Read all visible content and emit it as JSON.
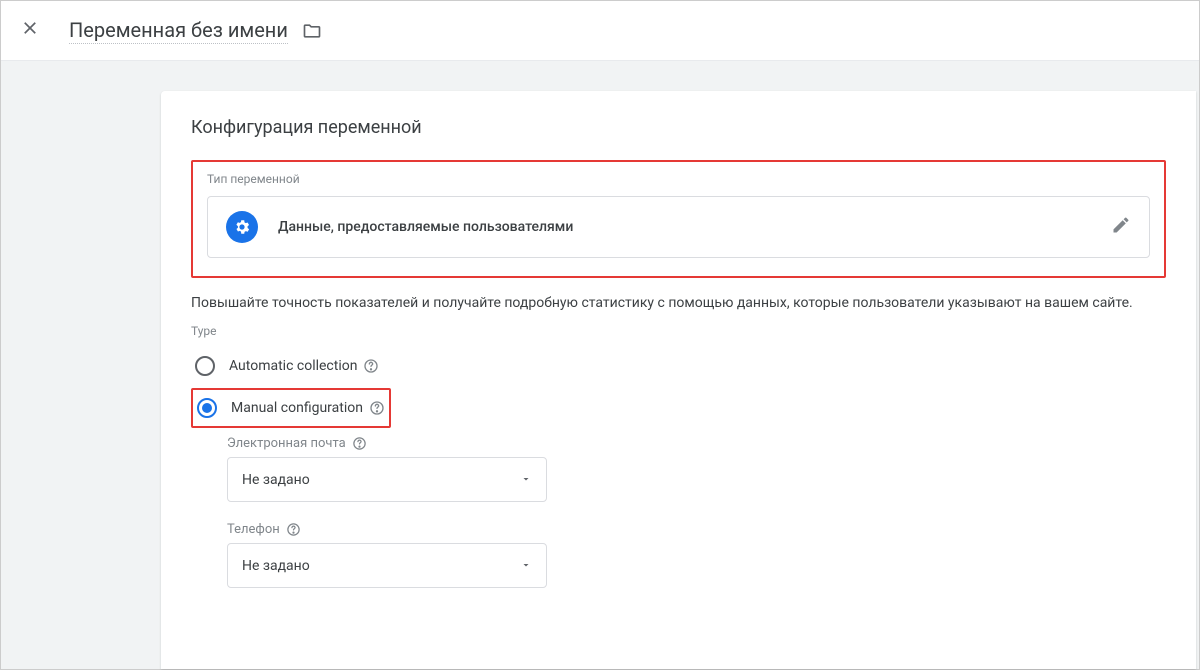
{
  "header": {
    "title": "Переменная без имени"
  },
  "card": {
    "title": "Конфигурация переменной"
  },
  "variable_type": {
    "label": "Тип переменной",
    "name": "Данные, предоставляемые пользователями"
  },
  "description": "Повышайте точность показателей и получайте подробную статистику с помощью данных, которые пользователи указывают на вашем сайте.",
  "type_section": {
    "label": "Type",
    "options": {
      "automatic": "Automatic collection",
      "manual": "Manual configuration"
    }
  },
  "fields": {
    "email": {
      "label": "Электронная почта",
      "value": "Не задано"
    },
    "phone": {
      "label": "Телефон",
      "value": "Не задано"
    }
  }
}
